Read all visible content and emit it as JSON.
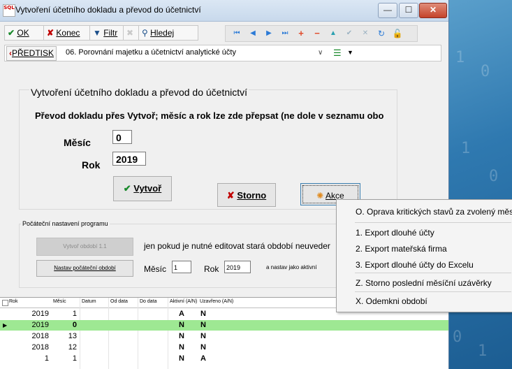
{
  "window": {
    "title": "Vytvoření účetního dokladu a převod do účetnictví",
    "app_icon_text": "SQL",
    "minimize_glyph": "—",
    "maximize_glyph": "☐",
    "close_glyph": "✕"
  },
  "toolbar": {
    "ok_label": "OK",
    "konec_label": "Konec",
    "filtr_label": "Filtr",
    "hledej_label": "Hledej",
    "nav_icons": [
      "first-record-icon",
      "prev-record-icon",
      "next-record-icon",
      "last-record-icon",
      "insert-record-icon",
      "delete-record-icon",
      "up-icon",
      "confirm-icon",
      "cancel-icon",
      "refresh-icon",
      "lock-icon"
    ]
  },
  "record_bar": {
    "predtisk_label": "PŘEDTISK",
    "selected_option": "06. Porovnání majetku a účetnictví analytické účty"
  },
  "form": {
    "group_title": "Vytvoření účetního dokladu a převod do účetnictví",
    "hint": "Převod dokladu přes Vytvoř; měsíc a rok lze zde přepsat (ne dole v seznamu obo",
    "mesic_label": "Měsíc",
    "mesic_value": "0",
    "rok_label": "Rok",
    "rok_value": "2019",
    "vytvor_label": "Vytvoř",
    "storno_label": "Storno",
    "akce_label": "Akce"
  },
  "settings": {
    "group_title": "Počáteční nastavení programu",
    "vytvor_obdobi_label": "Vytvoř období 1.1",
    "edit_note": "jen pokud je nutné editovat stará období neuveder",
    "nastav_label": "Nastav počáteční období",
    "mesic_label": "Měsíc",
    "mesic_value": "1",
    "rok_label": "Rok",
    "rok_value": "2019",
    "active_note": "a nastav jako aktivní"
  },
  "grid": {
    "columns": [
      "Rok",
      "Měsíc",
      "Datum",
      "Od data",
      "Do data",
      "Aktivní (A/N)",
      "Uzavřeno (A/N)"
    ],
    "rows": [
      {
        "rok": "2019",
        "mesic": "1",
        "datum": "",
        "od": "",
        "do": "",
        "aktivni": "A",
        "uzavreno": "N"
      },
      {
        "rok": "2019",
        "mesic": "0",
        "datum": "",
        "od": "",
        "do": "",
        "aktivni": "N",
        "uzavreno": "N"
      },
      {
        "rok": "2018",
        "mesic": "13",
        "datum": "",
        "od": "",
        "do": "",
        "aktivni": "N",
        "uzavreno": "N"
      },
      {
        "rok": "2018",
        "mesic": "12",
        "datum": "",
        "od": "",
        "do": "",
        "aktivni": "N",
        "uzavreno": "N"
      },
      {
        "rok": "1",
        "mesic": "1",
        "datum": "",
        "od": "",
        "do": "",
        "aktivni": "N",
        "uzavreno": "A"
      }
    ],
    "selected_row": 1
  },
  "menu": {
    "items": [
      "O. Oprava kritických stavů za zvolený měsíc",
      "1. Export dlouhé účty",
      "2. Export mateřská firma",
      "3. Export dlouhé účty do Excelu",
      "Z. Storno poslední měsíční uzávěrky",
      "X. Odemkni období"
    ]
  },
  "colors": {
    "selected_row": "#9ee893",
    "accent_green": "#1a8a2c",
    "accent_red": "#c00000",
    "accent_orange": "#e08a1e",
    "desktop_blue": "#2f79b0"
  }
}
